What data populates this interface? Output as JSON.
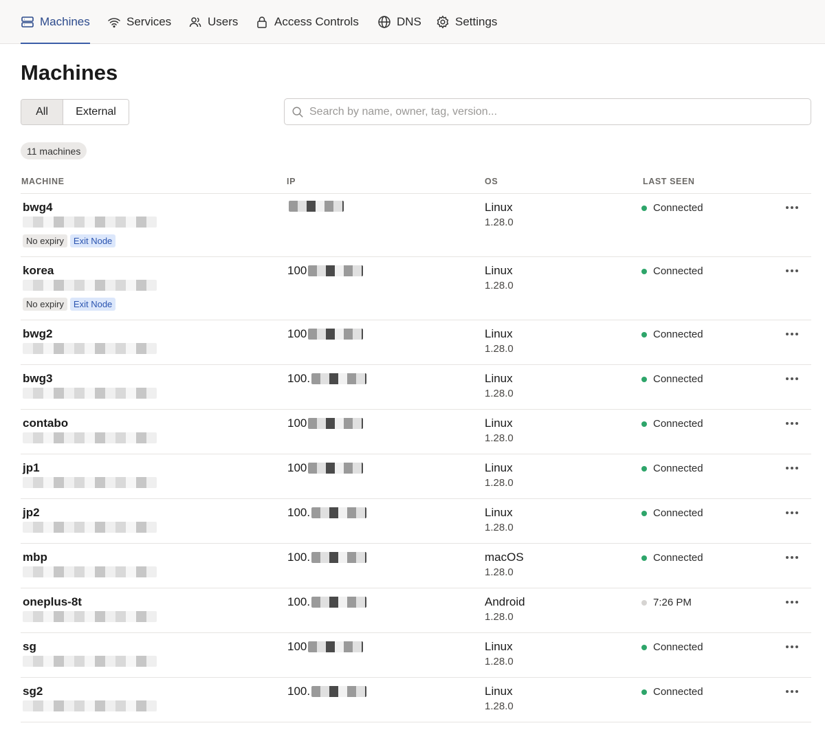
{
  "nav": {
    "tabs": [
      {
        "label": "Machines",
        "icon": "server-icon",
        "active": true
      },
      {
        "label": "Services",
        "icon": "wifi-icon",
        "active": false
      },
      {
        "label": "Users",
        "icon": "users-icon",
        "active": false
      },
      {
        "label": "Access Controls",
        "icon": "lock-icon",
        "active": false
      },
      {
        "label": "DNS",
        "icon": "globe-icon",
        "active": false
      },
      {
        "label": "Settings",
        "icon": "gear-icon",
        "active": false
      }
    ]
  },
  "page": {
    "title": "Machines"
  },
  "filter": {
    "all_label": "All",
    "external_label": "External",
    "selected": "All"
  },
  "search": {
    "placeholder": "Search by name, owner, tag, version..."
  },
  "summary": {
    "count_label": "11 machines"
  },
  "table": {
    "headers": {
      "machine": "MACHINE",
      "ip": "IP",
      "os": "OS",
      "last_seen": "LAST SEEN"
    },
    "rows": [
      {
        "name": "bwg4",
        "ip_prefix": "",
        "os": "Linux",
        "version": "1.28.0",
        "last_seen": "Connected",
        "online": true,
        "badges": [
          "No expiry",
          "Exit Node"
        ]
      },
      {
        "name": "korea",
        "ip_prefix": "100",
        "os": "Linux",
        "version": "1.28.0",
        "last_seen": "Connected",
        "online": true,
        "badges": [
          "No expiry",
          "Exit Node"
        ]
      },
      {
        "name": "bwg2",
        "ip_prefix": "100",
        "os": "Linux",
        "version": "1.28.0",
        "last_seen": "Connected",
        "online": true,
        "badges": []
      },
      {
        "name": "bwg3",
        "ip_prefix": "100.",
        "os": "Linux",
        "version": "1.28.0",
        "last_seen": "Connected",
        "online": true,
        "badges": []
      },
      {
        "name": "contabo",
        "ip_prefix": "100",
        "os": "Linux",
        "version": "1.28.0",
        "last_seen": "Connected",
        "online": true,
        "badges": []
      },
      {
        "name": "jp1",
        "ip_prefix": "100",
        "os": "Linux",
        "version": "1.28.0",
        "last_seen": "Connected",
        "online": true,
        "badges": []
      },
      {
        "name": "jp2",
        "ip_prefix": "100.",
        "os": "Linux",
        "version": "1.28.0",
        "last_seen": "Connected",
        "online": true,
        "badges": []
      },
      {
        "name": "mbp",
        "ip_prefix": "100.",
        "os": "macOS",
        "version": "1.28.0",
        "last_seen": "Connected",
        "online": true,
        "badges": []
      },
      {
        "name": "oneplus-8t",
        "ip_prefix": "100.",
        "os": "Android",
        "version": "1.28.0",
        "last_seen": "7:26 PM",
        "online": false,
        "badges": []
      },
      {
        "name": "sg",
        "ip_prefix": "100",
        "os": "Linux",
        "version": "1.28.0",
        "last_seen": "Connected",
        "online": true,
        "badges": []
      },
      {
        "name": "sg2",
        "ip_prefix": "100.",
        "os": "Linux",
        "version": "1.28.0",
        "last_seen": "Connected",
        "online": true,
        "badges": []
      }
    ]
  },
  "colors": {
    "accent": "#2c4a8c",
    "online": "#2ea56a",
    "offline": "#d6d4d2",
    "exit_badge": "#dce7fb"
  }
}
